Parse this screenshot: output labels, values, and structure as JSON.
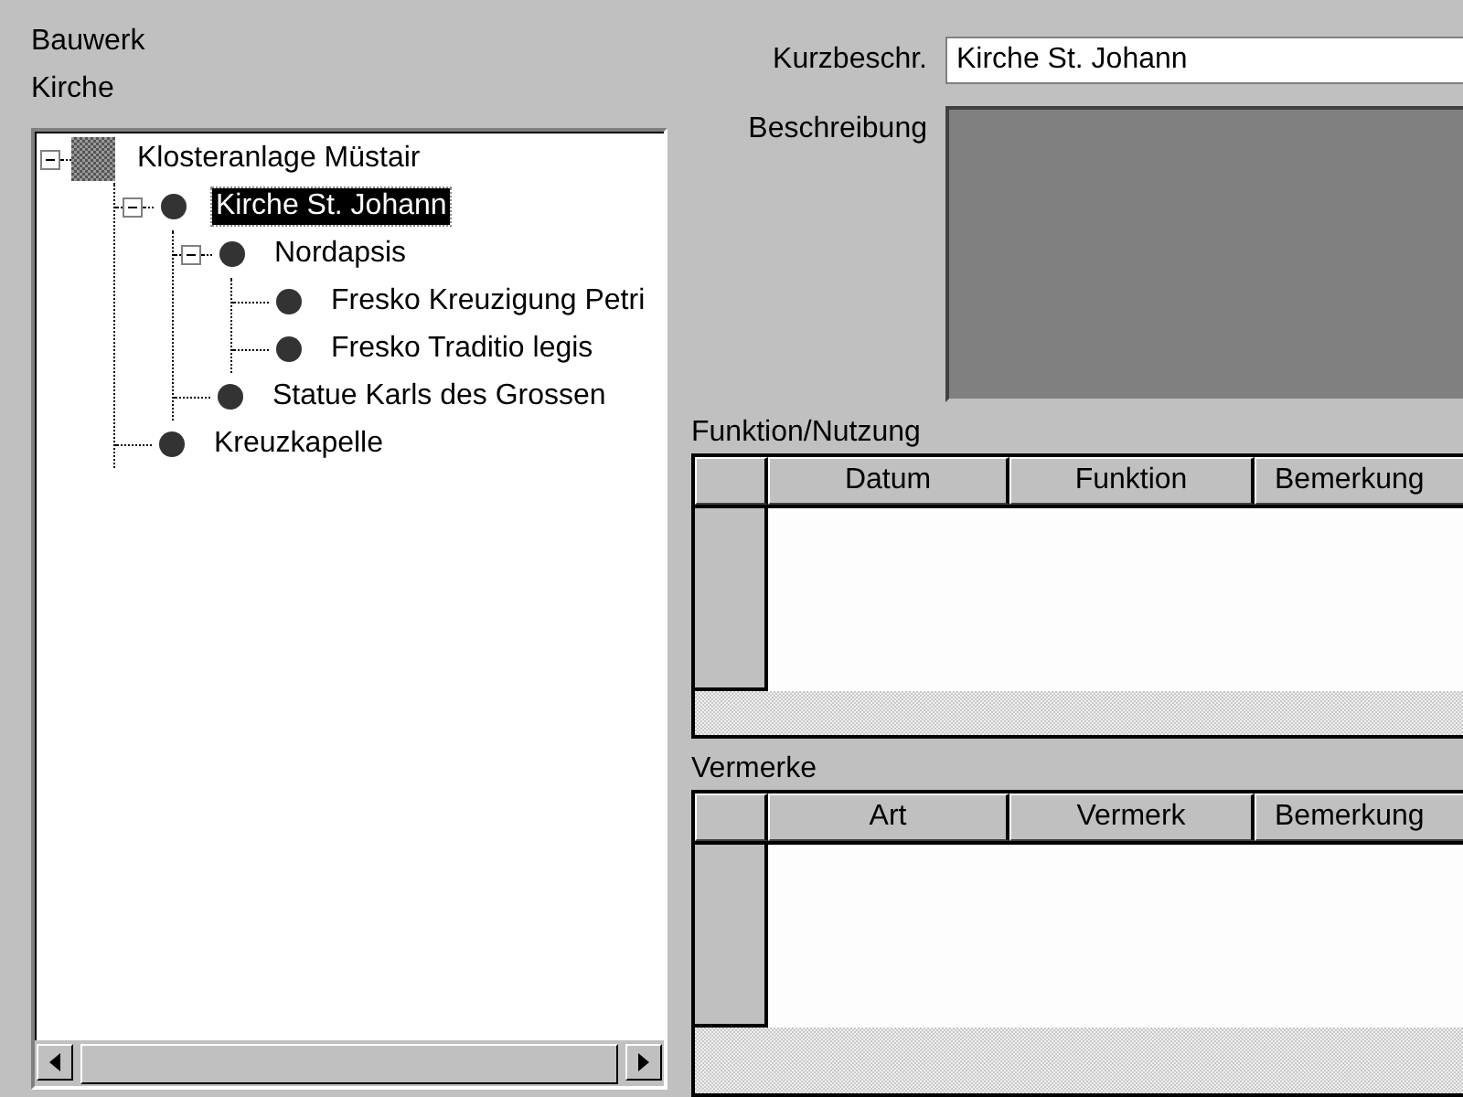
{
  "header": {
    "title": "Bauwerk",
    "subtitle": "Kirche"
  },
  "tree": {
    "items": [
      {
        "label": "Klosteranlage Müstair",
        "kind": "group",
        "expanded": true,
        "selected": false,
        "children": [
          {
            "label": "Kirche St. Johann",
            "kind": "item",
            "expanded": true,
            "selected": true,
            "children": [
              {
                "label": "Nordapsis",
                "kind": "item",
                "expanded": true,
                "selected": false,
                "children": [
                  {
                    "label": "Fresko Kreuzigung Petri",
                    "kind": "item",
                    "selected": false
                  },
                  {
                    "label": "Fresko Traditio legis",
                    "kind": "item",
                    "selected": false
                  }
                ]
              },
              {
                "label": "Statue Karls des Grossen",
                "kind": "item",
                "selected": false
              }
            ]
          },
          {
            "label": "Kreuzkapelle",
            "kind": "item",
            "selected": false
          }
        ]
      }
    ]
  },
  "form": {
    "short_label": "Kurzbeschr.",
    "short_value": "Kirche St. Johann",
    "description_label": "Beschreibung"
  },
  "grids": [
    {
      "title": "Funktion/Nutzung",
      "columns": [
        "Datum",
        "Funktion",
        "Bemerkung"
      ]
    },
    {
      "title": "Vermerke",
      "columns": [
        "Art",
        "Vermerk",
        "Bemerkung"
      ]
    }
  ]
}
